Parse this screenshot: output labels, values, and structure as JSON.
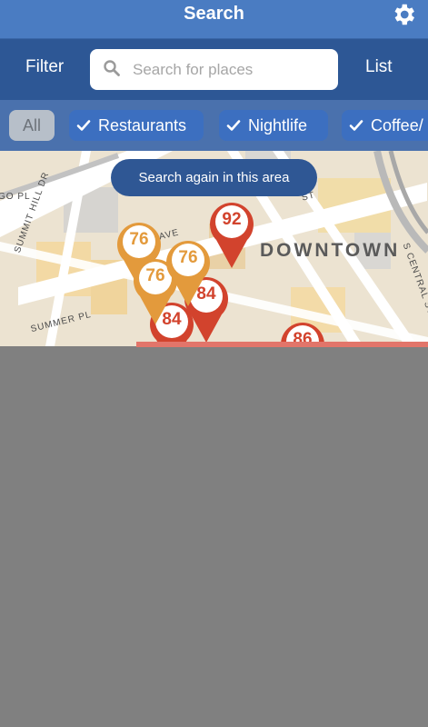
{
  "header": {
    "title": "Search",
    "settings_icon": "gear-icon"
  },
  "toolbar": {
    "filter_label": "Filter",
    "list_label": "List",
    "search_placeholder": "Search for places",
    "search_value": ""
  },
  "categories": [
    {
      "label": "All",
      "selected": false
    },
    {
      "label": "Restaurants",
      "selected": true
    },
    {
      "label": "Nightlife",
      "selected": true
    },
    {
      "label": "Coffee/",
      "selected": true
    }
  ],
  "map": {
    "search_again_label": "Search again in this area",
    "district_label": "DOWNTOWN",
    "streets": [
      "GO PL",
      "SUMMIT HILL DR",
      "SUMMER PL",
      "S CENTRAL ST",
      "AVE",
      "ST"
    ],
    "pins": [
      {
        "score": "92",
        "color": "red"
      },
      {
        "score": "76",
        "color": "orange"
      },
      {
        "score": "76",
        "color": "orange"
      },
      {
        "score": "76",
        "color": "orange"
      },
      {
        "score": "84",
        "color": "red"
      },
      {
        "score": "84",
        "color": "red"
      },
      {
        "score": "86",
        "color": "red"
      }
    ]
  },
  "colors": {
    "header_bg": "#4a7cc2",
    "toolbar_bg": "#2d5795",
    "chip_bar_bg": "#4a71ad",
    "chip_active": "#3c6fc0",
    "pin_red": "#d2432d",
    "pin_orange": "#e39a3c"
  }
}
